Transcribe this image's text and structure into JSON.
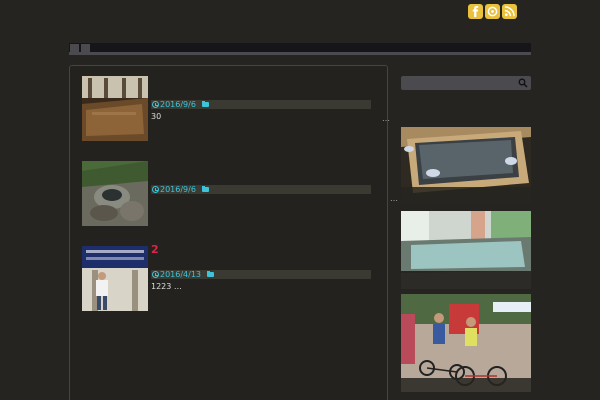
{
  "social": [
    {
      "name": "facebook-icon"
    },
    {
      "name": "hatena-icon"
    },
    {
      "name": "rss-icon"
    }
  ],
  "posts": [
    {
      "title": "",
      "date": "2016/9/6",
      "excerpt": "30",
      "more": "…"
    },
    {
      "title": "",
      "date": "2016/9/6",
      "excerpt": "",
      "more": "…"
    },
    {
      "title": "2",
      "date": "2016/4/13",
      "excerpt": "1223 …",
      "more": ""
    }
  ],
  "colors": {
    "background": "#262420",
    "accent": "#3cc4d8",
    "title": "#e0234a",
    "social": "#e9c13f"
  }
}
